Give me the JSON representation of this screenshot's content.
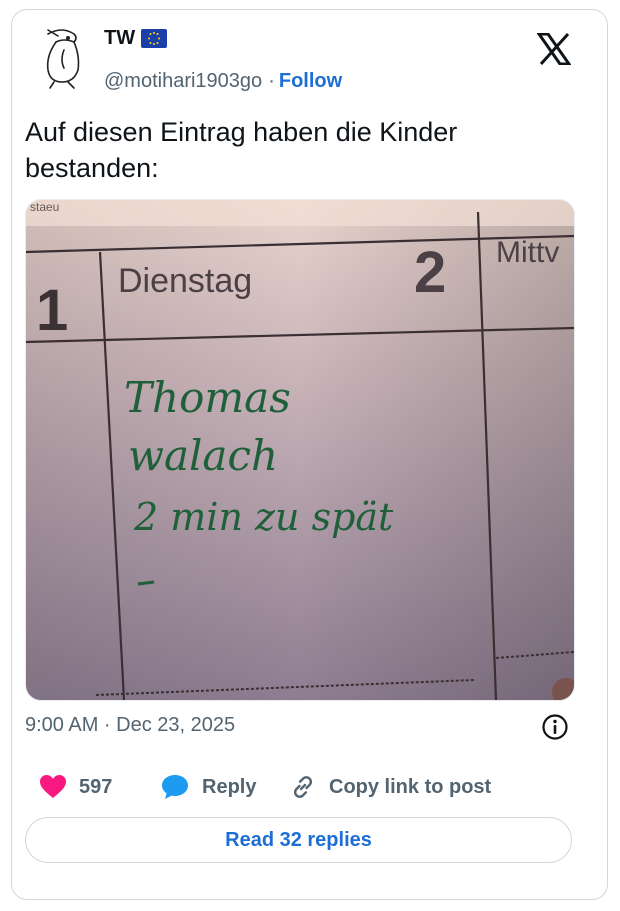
{
  "author": {
    "name": "TW",
    "handle": "@motihari1903go",
    "separator": "·",
    "follow_label": "Follow",
    "flag_icon": "eu-flag-icon",
    "avatar_icon": "penguin-sketch-avatar"
  },
  "post": {
    "text": "Auf diesen Eintrag haben die Kinder bestanden:",
    "timestamp": "9:00 AM · Dec 23, 2025"
  },
  "photo": {
    "header_number_left": "1",
    "header_day": "Dienstag",
    "header_number_right": "2",
    "header_next_day": "Mittv",
    "top_cut_text": "staeu",
    "handwriting_line1": "Thomas",
    "handwriting_line2": "walach",
    "handwriting_line3": "2 min zu spät"
  },
  "actions": {
    "likes": "597",
    "reply_label": "Reply",
    "copy_label": "Copy link to post",
    "read_replies_label": "Read 32 replies"
  },
  "colors": {
    "accent": "#1d6fd6",
    "like": "#f91880",
    "reply": "#1d9bf0",
    "muted": "#536471",
    "ink_green": "#1f5f3a"
  }
}
